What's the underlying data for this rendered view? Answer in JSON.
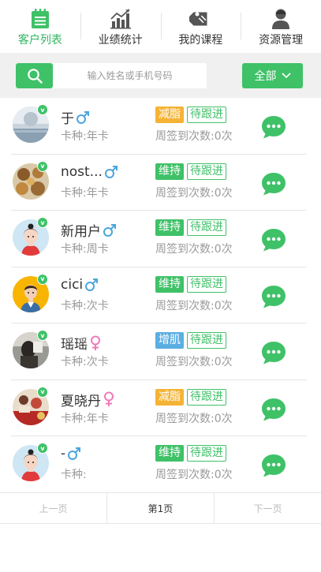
{
  "tabs": [
    {
      "label": "客户列表",
      "icon": "customer-list-icon",
      "active": true
    },
    {
      "label": "业绩统计",
      "icon": "bar-chart-icon",
      "active": false
    },
    {
      "label": "我的课程",
      "icon": "tag-icon",
      "active": false
    },
    {
      "label": "资源管理",
      "icon": "user-icon",
      "active": false
    }
  ],
  "search": {
    "placeholder": "输入姓名或手机号码",
    "filter_label": "全部"
  },
  "colors": {
    "green": "#3fc168",
    "orange": "#f5b335",
    "blue": "#5aaee2",
    "male": "#4aa6de",
    "female": "#f07ab8"
  },
  "customers": [
    {
      "name": "于",
      "gender": "male",
      "card": "卡种:年卡",
      "tag": "减脂",
      "tag_color": "orange",
      "status": "待跟进",
      "visits": "周签到次数:0次",
      "avatar": "landscape"
    },
    {
      "name": "nost...",
      "gender": "male",
      "card": "卡种:年卡",
      "tag": "维持",
      "tag_color": "green",
      "status": "待跟进",
      "visits": "周签到次数:0次",
      "avatar": "food"
    },
    {
      "name": "新用户",
      "gender": "male",
      "card": "卡种:周卡",
      "tag": "维持",
      "tag_color": "green",
      "status": "待跟进",
      "visits": "周签到次数:0次",
      "avatar": "girl"
    },
    {
      "name": "cici",
      "gender": "male",
      "card": "卡种:次卡",
      "tag": "维持",
      "tag_color": "green",
      "status": "待跟进",
      "visits": "周签到次数:0次",
      "avatar": "boy"
    },
    {
      "name": "瑶瑶",
      "gender": "female",
      "card": "卡种:次卡",
      "tag": "增肌",
      "tag_color": "blue",
      "status": "待跟进",
      "visits": "周签到次数:0次",
      "avatar": "photo"
    },
    {
      "name": "夏晓丹",
      "gender": "female",
      "card": "卡种:年卡",
      "tag": "减脂",
      "tag_color": "orange",
      "status": "待跟进",
      "visits": "周签到次数:0次",
      "avatar": "red"
    },
    {
      "name": "-",
      "gender": "male",
      "card": "卡种:",
      "tag": "维持",
      "tag_color": "green",
      "status": "待跟进",
      "visits": "周签到次数:0次",
      "avatar": "girl"
    }
  ],
  "pager": {
    "prev": "上一页",
    "current": "第1页",
    "next": "下一页"
  }
}
